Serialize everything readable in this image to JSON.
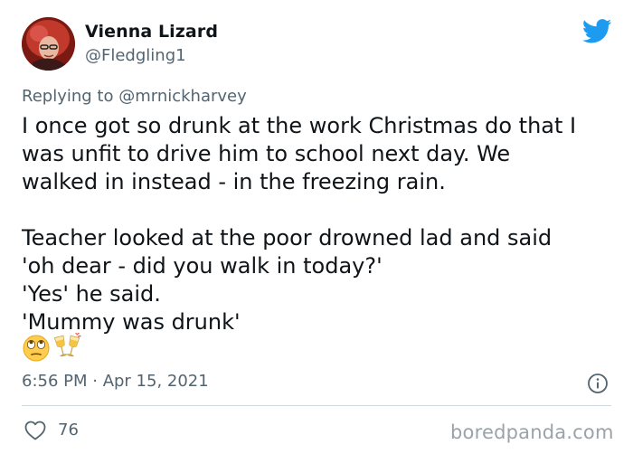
{
  "tweet": {
    "author_name": "Vienna Lizard",
    "author_handle": "@Fledgling1",
    "replying_prefix": "Replying to ",
    "replying_to": "@mrnickharvey",
    "lines": [
      "I once got so drunk at the work Christmas do that I",
      "was unfit to drive him to school next day. We",
      "walked in instead - in the freezing rain.",
      "Teacher looked at the poor drowned lad and said",
      "'oh dear - did you walk in today?'",
      "'Yes' he said.",
      "'Mummy was drunk'"
    ],
    "emojis": [
      "face-with-rolling-eyes-emoji",
      "clinking-glasses-emoji"
    ],
    "timestamp": "6:56 PM · Apr 15, 2021",
    "like_count": "76"
  },
  "icons": {
    "brand": "twitter-bird-icon",
    "info": "info-icon",
    "like": "heart-icon"
  },
  "colors": {
    "text": "#0f1419",
    "secondary": "#536471",
    "twitter_blue": "#1d9bf0",
    "divider": "#cfd9de",
    "watermark": "#9aa3a8"
  },
  "watermark": "boredpanda.com"
}
